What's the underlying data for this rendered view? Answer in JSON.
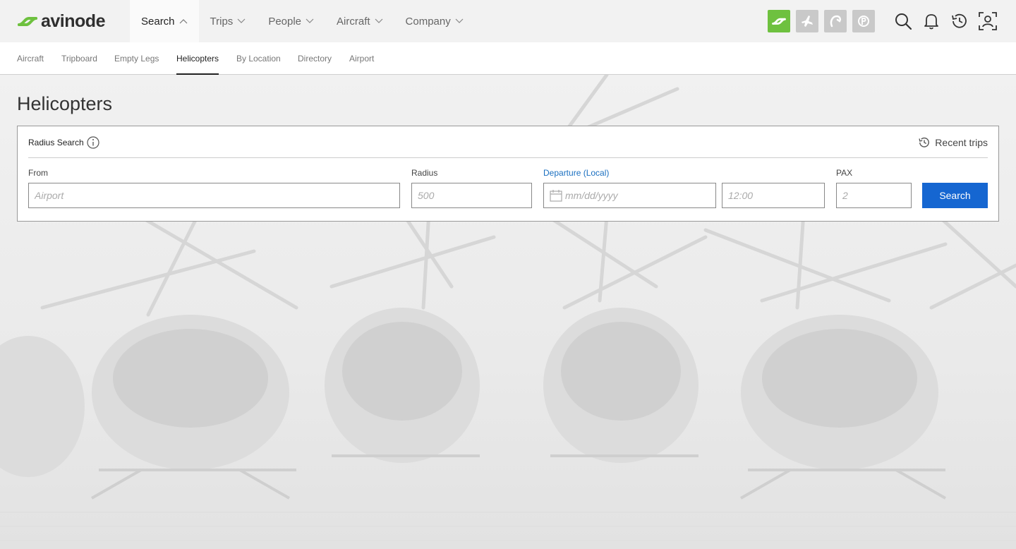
{
  "brand": {
    "name": "avinode",
    "accent": "#6ec13f"
  },
  "mainnav": [
    {
      "label": "Search",
      "active": true
    },
    {
      "label": "Trips"
    },
    {
      "label": "People"
    },
    {
      "label": "Aircraft"
    },
    {
      "label": "Company"
    }
  ],
  "apps": [
    "avinode-app-icon",
    "plane-app-icon",
    "arc-app-icon",
    "paynode-app-icon"
  ],
  "tools": [
    "search-icon",
    "bell-icon",
    "history-icon",
    "profile-icon"
  ],
  "subnav": [
    {
      "label": "Aircraft"
    },
    {
      "label": "Tripboard"
    },
    {
      "label": "Empty Legs"
    },
    {
      "label": "Helicopters",
      "active": true
    },
    {
      "label": "By Location"
    },
    {
      "label": "Directory"
    },
    {
      "label": "Airport"
    }
  ],
  "page": {
    "title": "Helicopters"
  },
  "search": {
    "heading": "Radius Search",
    "recent_label": "Recent trips",
    "from_label": "From",
    "from_placeholder": "Airport",
    "radius_label": "Radius",
    "radius_placeholder": "500",
    "departure_label": "Departure (Local)",
    "date_placeholder": "mm/dd/yyyy",
    "time_placeholder": "12:00",
    "pax_label": "PAX",
    "pax_placeholder": "2",
    "button_label": "Search",
    "button_color": "#1566d1"
  }
}
